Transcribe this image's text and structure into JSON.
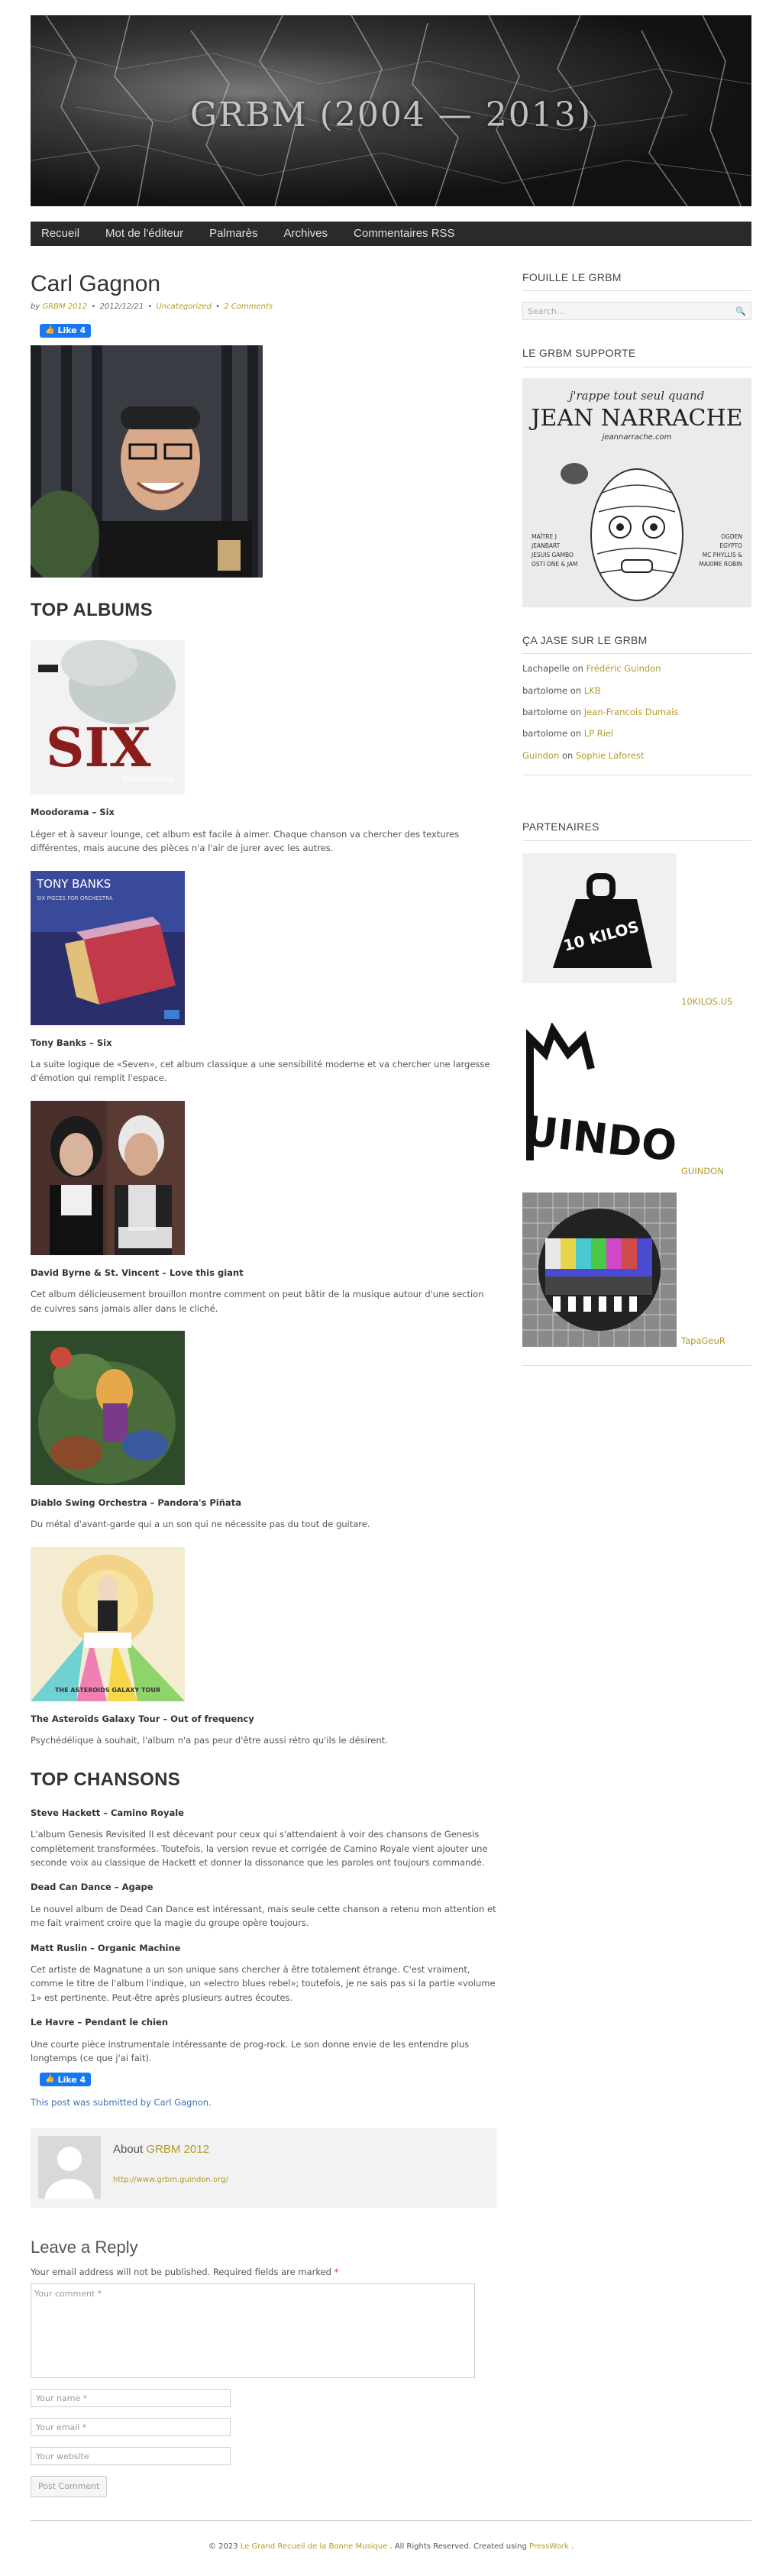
{
  "site": {
    "title": "GRBM (2004 — 2013)",
    "nav": [
      "Recueil",
      "Mot de l'éditeur",
      "Palmarès",
      "Archives",
      "Commentaires RSS"
    ]
  },
  "post": {
    "title": "Carl Gagnon",
    "meta_by": "by",
    "meta_author": "GRBM 2012",
    "meta_date": "2012/12/21",
    "meta_category": "Uncategorized",
    "meta_comments": "2 Comments",
    "like_label": "Like 4",
    "like_label_bottom": "Like 4",
    "top_albums_heading": "TOP ALBUMS",
    "albums": [
      {
        "title": "Moodorama – Six",
        "desc": "Léger et à saveur lounge, cet album est facile à aimer. Chaque chanson va chercher des textures différentes, mais aucune des pièces n'a l'air de jurer avec les autres."
      },
      {
        "title": "Tony Banks – Six",
        "desc": "La suite logique de «Seven», cet album classique a une sensibilité moderne et va chercher une largesse d'émotion qui remplit l'espace."
      },
      {
        "title": "David Byrne & St. Vincent – Love this giant",
        "desc": "Cet album délicieusement brouillon montre comment on peut bâtir de la musique autour d'une section de cuivres sans jamais aller dans le cliché."
      },
      {
        "title": "Diablo Swing Orchestra – Pandora's Piñata",
        "desc": "Du métal d'avant-garde qui a un son qui ne nécessite pas du tout de guitare."
      },
      {
        "title": "The Asteroids Galaxy Tour – Out of frequency",
        "desc": "Psychédélique à souhait, l'album n'a pas peur d'être aussi rétro qu'ils le désirent."
      }
    ],
    "cover_text": {
      "moodorama": "SIX",
      "moodorama_small": "moodorama",
      "tony_banks": "TONY BANKS",
      "tony_banks_sub": "SIX PIECES FOR ORCHESTRA",
      "asteroids": "THE ASTEROIDS GALAXY TOUR"
    },
    "top_songs_heading": "TOP CHANSONS",
    "songs": [
      {
        "title": "Steve Hackett – Camino Royale",
        "desc": "L'album Genesis Revisited II est décevant pour ceux qui s'attendaient à voir des chansons de Genesis complètement transformées. Toutefois, la version revue et corrigée de Camino Royale vient ajouter une seconde voix au classique de Hackett et donner la dissonance que les paroles ont toujours commandé."
      },
      {
        "title": "Dead Can Dance – Agape",
        "desc": "Le nouvel album de Dead Can Dance est intéressant, mais seule cette chanson a retenu mon attention et me fait vraiment croire que la magie du groupe opère toujours."
      },
      {
        "title": "Matt Ruslin – Organic Machine",
        "desc": "Cet artiste de Magnatune a un son unique sans chercher à être totalement étrange. C'est vraiment, comme le titre de l'album l'indique, un «electro blues rebel»; toutefois, je ne sais pas si la partie «volume 1» est pertinente. Peut-être après plusieurs autres écoutes."
      },
      {
        "title": "Le Havre – Pendant le chien",
        "desc": "Une courte pièce instrumentale intéressante de prog-rock. Le son donne envie de les entendre plus longtemps (ce que j'ai fait)."
      }
    ],
    "submitted": "This post was submitted by Carl Gagnon."
  },
  "author_box": {
    "about": "About",
    "name": "GRBM 2012",
    "url": "http://www.grbm.guindon.org/"
  },
  "reply": {
    "title": "Leave a Reply",
    "note": "Your email address will not be published. Required fields are marked",
    "req": "*",
    "comment_placeholder": "Your comment *",
    "name_placeholder": "Your name *",
    "email_placeholder": "Your email *",
    "website_placeholder": "Your website",
    "submit_label": "Post Comment"
  },
  "sidebar": {
    "search_title": "FOUILLE LE GRBM",
    "search_placeholder": "Search...",
    "supporte_title": "LE GRBM SUPPORTE",
    "jean": {
      "line1": "j'rappe tout seul quand",
      "line2": "JEAN NARRACHE",
      "line3": "jeannarrache.com",
      "left": [
        "MAÎTRE J",
        "JEANBART",
        "JESUIS GAMBO",
        "OSTI ONE & JAM"
      ],
      "right": [
        "OGDEN",
        "EGYPTO",
        "MC PHYLLIS &",
        "MAXIME ROBIN"
      ]
    },
    "jase_title": "ÇA JASE SUR LE GRBM",
    "comments": [
      {
        "who": "Lachapelle",
        "on": "on",
        "what": "Frédéric Guindon"
      },
      {
        "who": "bartolome",
        "on": "on",
        "what": "LKB"
      },
      {
        "who": "bartolome",
        "on": "on",
        "what": "Jean-Francois Dumais"
      },
      {
        "who": "bartolome",
        "on": "on",
        "what": "LP Riel"
      },
      {
        "who": "Guindon",
        "on": "on",
        "what": "Sophie Laforest"
      }
    ],
    "partners_title": "PARTENAIRES",
    "partners": [
      {
        "label": "10KILOS.US",
        "logo_text": "10 KILOS"
      },
      {
        "label": "GUINDON",
        "logo_text": "GUINDON"
      },
      {
        "label": "TapaGeuR",
        "logo_text": ""
      }
    ]
  },
  "footer": {
    "pre": "© 2023",
    "site_link": "Le Grand Recueil de la Bonne Musique",
    "mid": ". All Rights Reserved. Created using",
    "theme_link": "PressWork",
    "end": "."
  }
}
